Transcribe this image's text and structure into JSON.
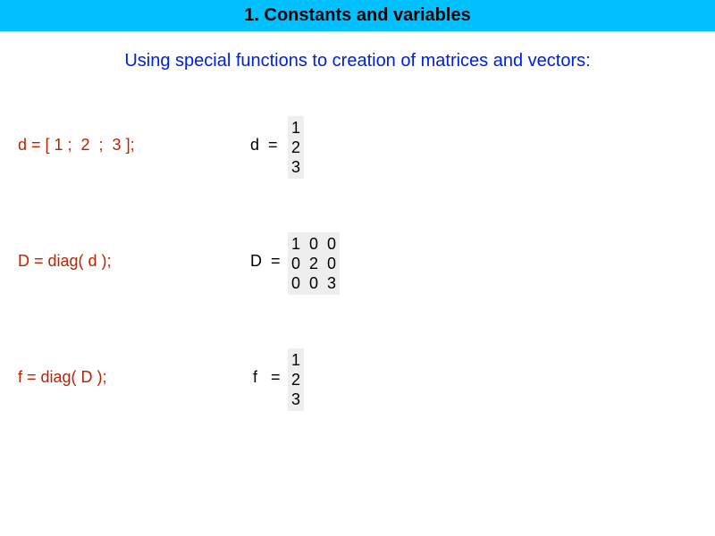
{
  "header": "1. Constants and variables",
  "subtitle": "Using special functions to creation of matrices and vectors:",
  "rows": [
    {
      "code": "d = [ 1 ;  2  ;  3 ];",
      "label": "d  =",
      "matrix": "1\n2\n3"
    },
    {
      "code": "D = diag( d );",
      "label": "D  =",
      "matrix": "1  0  0\n0  2  0\n0  0  3"
    },
    {
      "code": "f = diag( D );",
      "label": "f   =",
      "matrix": "1\n2\n3"
    }
  ]
}
